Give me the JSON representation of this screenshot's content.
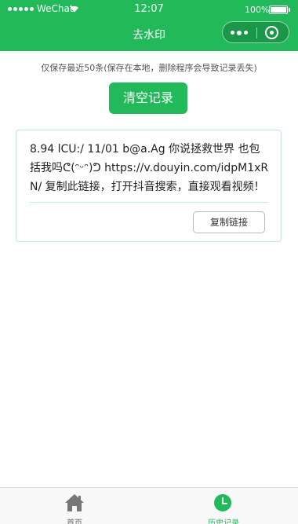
{
  "status_bar": {
    "carrier": "WeChat",
    "time": "12:07",
    "battery": "100%"
  },
  "nav": {
    "title": "去水印"
  },
  "history": {
    "tip": "仅保存最近50条(保存在本地，删除程序会导致记录丢失)",
    "clear_label": "清空记录",
    "records": [
      {
        "text": "8.94 lCU:/ 11/01 b@a.Ag 你说拯救世界 也包括我吗ᕦ(ᵔᵕᵔ)ᕤ https://v.douyin.com/idpM1xRN/ 复制此链接，打开抖音搜索，直接观看视频！",
        "copy_label": "复制链接"
      }
    ]
  },
  "tabbar": {
    "home_label": "首页",
    "history_label": "历史记录",
    "active_color": "#21b95a",
    "inactive_color": "#666666"
  },
  "colors": {
    "brand": "#21b95a",
    "card_border": "#bfe9d0"
  }
}
